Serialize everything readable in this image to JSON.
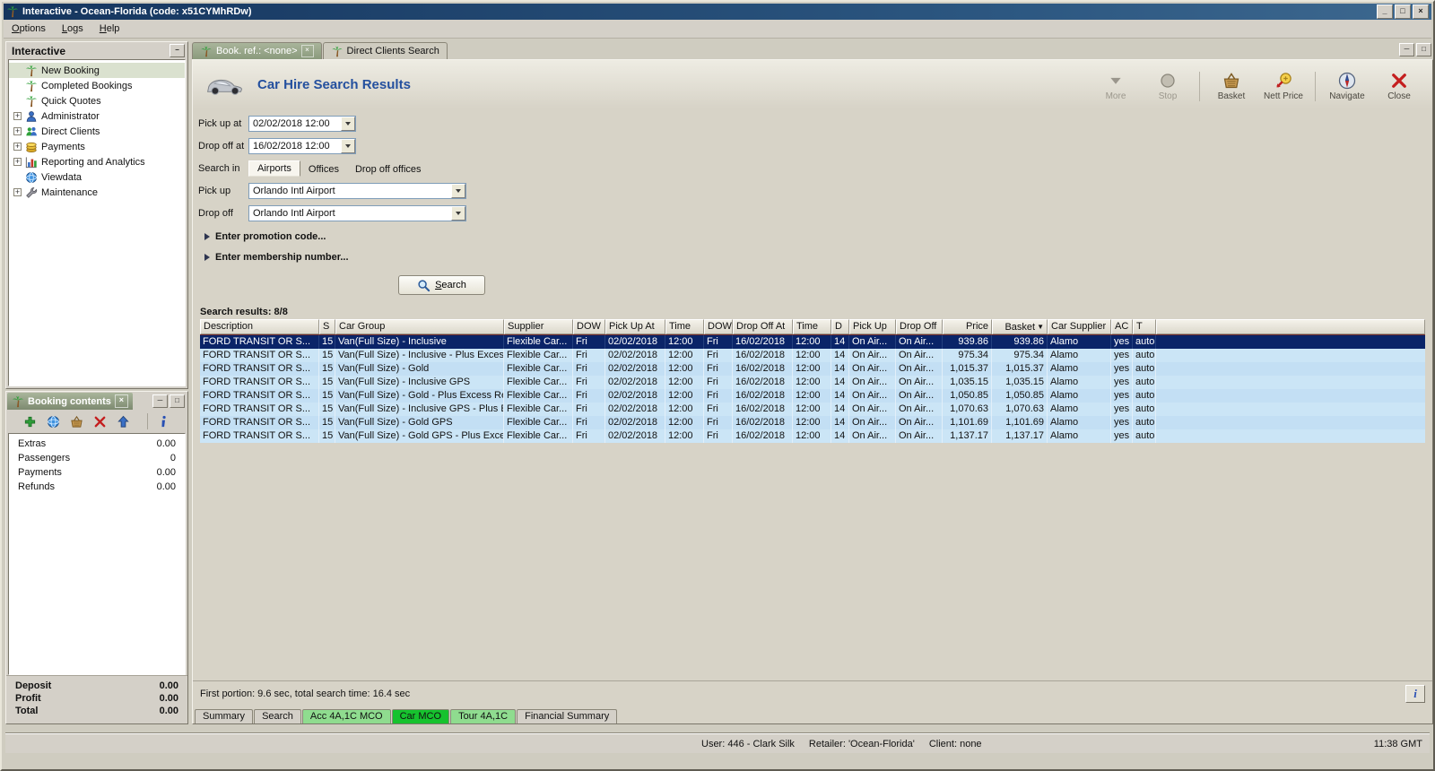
{
  "window": {
    "title": "Interactive - Ocean-Florida (code: x51CYMhRDw)",
    "menu": [
      {
        "label": "Options",
        "name": "menu-options"
      },
      {
        "label": "Logs",
        "name": "menu-logs"
      },
      {
        "label": "Help",
        "name": "menu-help"
      }
    ],
    "controls": {
      "minimize": "_",
      "maximize": "□",
      "close": "×"
    }
  },
  "sidebar": {
    "title": "Interactive",
    "collapse_glyph": "−",
    "items": [
      {
        "label": "New Booking",
        "icon": "palm",
        "selected": true,
        "name": "sidebar-item-new-booking"
      },
      {
        "label": "Completed Bookings",
        "icon": "palm",
        "name": "sidebar-item-completed-bookings"
      },
      {
        "label": "Quick Quotes",
        "icon": "palm",
        "name": "sidebar-item-quick-quotes"
      },
      {
        "label": "Administrator",
        "icon": "person",
        "expandable": true,
        "name": "sidebar-item-administrator"
      },
      {
        "label": "Direct Clients",
        "icon": "people",
        "expandable": true,
        "name": "sidebar-item-direct-clients"
      },
      {
        "label": "Payments",
        "icon": "coins",
        "expandable": true,
        "name": "sidebar-item-payments"
      },
      {
        "label": "Reporting and Analytics",
        "icon": "chart",
        "expandable": true,
        "name": "sidebar-item-reporting-and-analytics"
      },
      {
        "label": "Viewdata",
        "icon": "globe",
        "name": "sidebar-item-viewdata"
      },
      {
        "label": "Maintenance",
        "icon": "wrench",
        "expandable": true,
        "name": "sidebar-item-maintenance"
      }
    ]
  },
  "booking_contents": {
    "title": "Booking contents",
    "controls": {
      "close": "×",
      "min": "─",
      "max": "□"
    },
    "toolbar": [
      {
        "icon": "plus",
        "name": "add-item-button"
      },
      {
        "icon": "globe",
        "name": "view-item-button"
      },
      {
        "icon": "basket",
        "name": "to-basket-button"
      },
      {
        "icon": "closex",
        "name": "delete-item-button"
      },
      {
        "icon": "up",
        "name": "move-up-button"
      },
      {
        "icon": "info",
        "name": "item-info-button"
      }
    ],
    "rows": [
      {
        "label": "Extras",
        "value": "0.00"
      },
      {
        "label": "Passengers",
        "value": "0"
      },
      {
        "label": "Payments",
        "value": "0.00"
      },
      {
        "label": "Refunds",
        "value": "0.00"
      }
    ],
    "totals": [
      {
        "label": "Deposit",
        "value": "0.00"
      },
      {
        "label": "Profit",
        "value": "0.00"
      },
      {
        "label": "Total",
        "value": "0.00"
      }
    ]
  },
  "tabs": [
    {
      "label": "Book. ref.: <none>",
      "icon": "palm",
      "active": true,
      "closable": true,
      "name": "tab-book-ref"
    },
    {
      "label": "Direct Clients Search",
      "icon": "palm",
      "name": "tab-direct-clients-search"
    }
  ],
  "mdi": {
    "min": "─",
    "restore": "□"
  },
  "main": {
    "title": "Car Hire Search Results",
    "toolbar": [
      {
        "label": "More",
        "icon": "more",
        "disabled": true,
        "name": "more-button"
      },
      {
        "label": "Stop",
        "icon": "stop",
        "disabled": true,
        "name": "stop-button"
      },
      {
        "label": "Basket",
        "icon": "basket",
        "name": "basket-button"
      },
      {
        "label": "Nett Price",
        "icon": "nett",
        "name": "nett-price-button"
      },
      {
        "label": "Navigate",
        "icon": "navigate",
        "name": "navigate-button"
      },
      {
        "label": "Close",
        "icon": "closex",
        "name": "close-button"
      }
    ],
    "form": {
      "pickup_at": {
        "label": "Pick up at",
        "value": "02/02/2018 12:00"
      },
      "dropoff_at": {
        "label": "Drop off at",
        "value": "16/02/2018 12:00"
      },
      "search_in_label": "Search in",
      "search_in": [
        {
          "label": "Airports",
          "selected": true,
          "name": "search-in-airports"
        },
        {
          "label": "Offices",
          "name": "search-in-offices"
        },
        {
          "label": "Drop off offices",
          "name": "search-in-drop-off-offices"
        }
      ],
      "pickup": {
        "label": "Pick up",
        "value": "Orlando Intl Airport"
      },
      "dropoff": {
        "label": "Drop off",
        "value": "Orlando Intl Airport"
      },
      "promotion": "Enter promotion code...",
      "membership": "Enter membership number...",
      "search_button": "Search"
    },
    "results_label": "Search results: 8/8",
    "table": {
      "sort_icon": "▼",
      "columns": [
        "Description",
        "S",
        "Car Group",
        "Supplier",
        "DOW",
        "Pick Up At",
        "Time",
        "DOW",
        "Drop Off At",
        "Time",
        "D",
        "Pick Up",
        "Drop Off",
        "Price",
        "Basket",
        "Car Supplier",
        "AC",
        "T"
      ],
      "rows": [
        {
          "desc": "FORD TRANSIT OR S...",
          "s": "15",
          "group": "Van(Full Size) - Inclusive",
          "supplier": "Flexible Car...",
          "dow1": "Fri",
          "pick_date": "02/02/2018",
          "time1": "12:00",
          "dow2": "Fri",
          "drop_date": "16/02/2018",
          "time2": "12:00",
          "d": "14",
          "pick_loc": "On Air...",
          "drop_loc": "On Air...",
          "price": "939.86",
          "basket": "939.86",
          "car_supplier": "Alamo",
          "ac": "yes",
          "t": "auto",
          "selected": true
        },
        {
          "desc": "FORD TRANSIT OR S...",
          "s": "15",
          "group": "Van(Full Size) - Inclusive - Plus Excess...",
          "supplier": "Flexible Car...",
          "dow1": "Fri",
          "pick_date": "02/02/2018",
          "time1": "12:00",
          "dow2": "Fri",
          "drop_date": "16/02/2018",
          "time2": "12:00",
          "d": "14",
          "pick_loc": "On Air...",
          "drop_loc": "On Air...",
          "price": "975.34",
          "basket": "975.34",
          "car_supplier": "Alamo",
          "ac": "yes",
          "t": "auto"
        },
        {
          "desc": "FORD TRANSIT OR S...",
          "s": "15",
          "group": "Van(Full Size) - Gold",
          "supplier": "Flexible Car...",
          "dow1": "Fri",
          "pick_date": "02/02/2018",
          "time1": "12:00",
          "dow2": "Fri",
          "drop_date": "16/02/2018",
          "time2": "12:00",
          "d": "14",
          "pick_loc": "On Air...",
          "drop_loc": "On Air...",
          "price": "1,015.37",
          "basket": "1,015.37",
          "car_supplier": "Alamo",
          "ac": "yes",
          "t": "auto"
        },
        {
          "desc": "FORD TRANSIT OR S...",
          "s": "15",
          "group": "Van(Full Size) - Inclusive GPS",
          "supplier": "Flexible Car...",
          "dow1": "Fri",
          "pick_date": "02/02/2018",
          "time1": "12:00",
          "dow2": "Fri",
          "drop_date": "16/02/2018",
          "time2": "12:00",
          "d": "14",
          "pick_loc": "On Air...",
          "drop_loc": "On Air...",
          "price": "1,035.15",
          "basket": "1,035.15",
          "car_supplier": "Alamo",
          "ac": "yes",
          "t": "auto"
        },
        {
          "desc": "FORD TRANSIT OR S...",
          "s": "15",
          "group": "Van(Full Size) - Gold - Plus Excess Ref...",
          "supplier": "Flexible Car...",
          "dow1": "Fri",
          "pick_date": "02/02/2018",
          "time1": "12:00",
          "dow2": "Fri",
          "drop_date": "16/02/2018",
          "time2": "12:00",
          "d": "14",
          "pick_loc": "On Air...",
          "drop_loc": "On Air...",
          "price": "1,050.85",
          "basket": "1,050.85",
          "car_supplier": "Alamo",
          "ac": "yes",
          "t": "auto"
        },
        {
          "desc": "FORD TRANSIT OR S...",
          "s": "15",
          "group": "Van(Full Size) - Inclusive GPS - Plus Ex...",
          "supplier": "Flexible Car...",
          "dow1": "Fri",
          "pick_date": "02/02/2018",
          "time1": "12:00",
          "dow2": "Fri",
          "drop_date": "16/02/2018",
          "time2": "12:00",
          "d": "14",
          "pick_loc": "On Air...",
          "drop_loc": "On Air...",
          "price": "1,070.63",
          "basket": "1,070.63",
          "car_supplier": "Alamo",
          "ac": "yes",
          "t": "auto"
        },
        {
          "desc": "FORD TRANSIT OR S...",
          "s": "15",
          "group": "Van(Full Size) - Gold GPS",
          "supplier": "Flexible Car...",
          "dow1": "Fri",
          "pick_date": "02/02/2018",
          "time1": "12:00",
          "dow2": "Fri",
          "drop_date": "16/02/2018",
          "time2": "12:00",
          "d": "14",
          "pick_loc": "On Air...",
          "drop_loc": "On Air...",
          "price": "1,101.69",
          "basket": "1,101.69",
          "car_supplier": "Alamo",
          "ac": "yes",
          "t": "auto"
        },
        {
          "desc": "FORD TRANSIT OR S...",
          "s": "15",
          "group": "Van(Full Size) - Gold GPS - Plus Excess...",
          "supplier": "Flexible Car...",
          "dow1": "Fri",
          "pick_date": "02/02/2018",
          "time1": "12:00",
          "dow2": "Fri",
          "drop_date": "16/02/2018",
          "time2": "12:00",
          "d": "14",
          "pick_loc": "On Air...",
          "drop_loc": "On Air...",
          "price": "1,137.17",
          "basket": "1,137.17",
          "car_supplier": "Alamo",
          "ac": "yes",
          "t": "auto"
        }
      ]
    },
    "status": "First portion: 9.6 sec, total search time: 16.4 sec",
    "info_button": "i",
    "bottom_tabs": [
      {
        "label": "Summary",
        "name": "tab-summary"
      },
      {
        "label": "Search",
        "name": "tab-search"
      },
      {
        "label": "Acc 4A,1C MCO",
        "green": true,
        "name": "tab-acc-4a1c-mco"
      },
      {
        "label": "Car MCO",
        "green": true,
        "active": true,
        "name": "tab-car-mco"
      },
      {
        "label": "Tour 4A,1C",
        "green": true,
        "name": "tab-tour-4a1c"
      },
      {
        "label": "Financial Summary",
        "name": "tab-financial-summary"
      }
    ]
  },
  "statusbar": {
    "user": "User: 446 - Clark Silk",
    "retailer": "Retailer: 'Ocean-Florida'",
    "client": "Client: none",
    "time": "11:38 GMT"
  }
}
